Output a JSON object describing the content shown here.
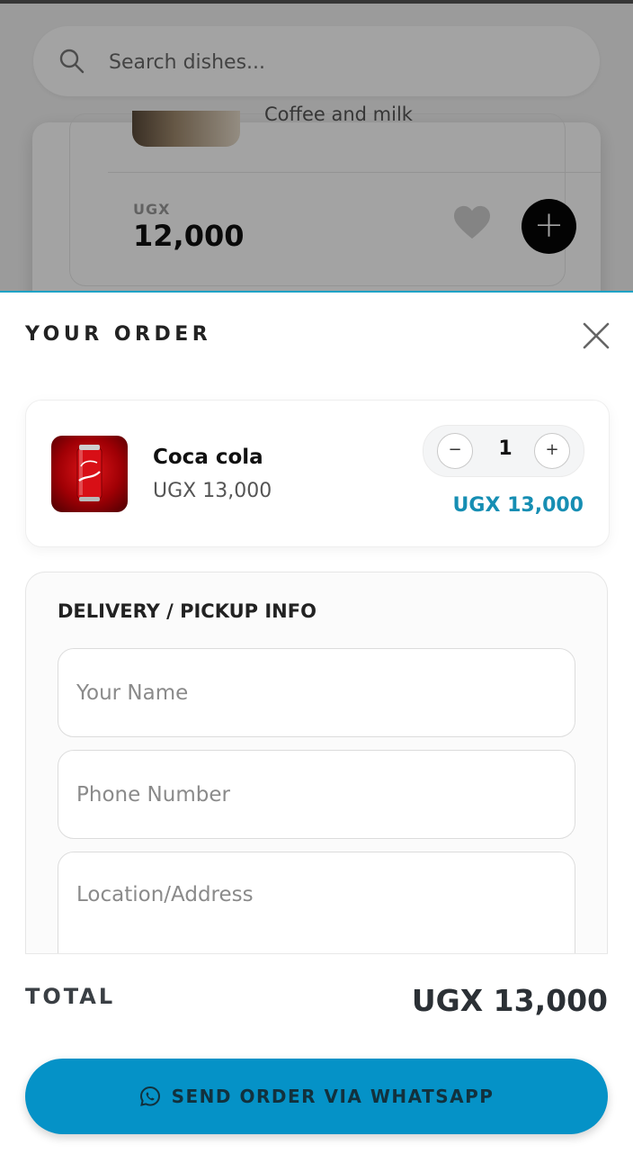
{
  "search": {
    "placeholder": "Search dishes..."
  },
  "background_card": {
    "description": "Coffee and milk",
    "currency": "UGX",
    "price": "12,000"
  },
  "order_sheet": {
    "title": "YOUR ORDER",
    "items": [
      {
        "name": "Coca cola",
        "unit_price": "UGX 13,000",
        "quantity": "1",
        "line_total": "UGX 13,000"
      }
    ],
    "delivery": {
      "title": "DELIVERY / PICKUP INFO",
      "name_placeholder": "Your Name",
      "phone_placeholder": "Phone Number",
      "location_placeholder": "Location/Address"
    },
    "total_label": "TOTAL",
    "total_value": "UGX 13,000",
    "send_button": "SEND ORDER VIA WHATSAPP"
  },
  "colors": {
    "accent": "#168eb3",
    "button": "#0592c7",
    "sheet_border": "#17a2c5"
  }
}
